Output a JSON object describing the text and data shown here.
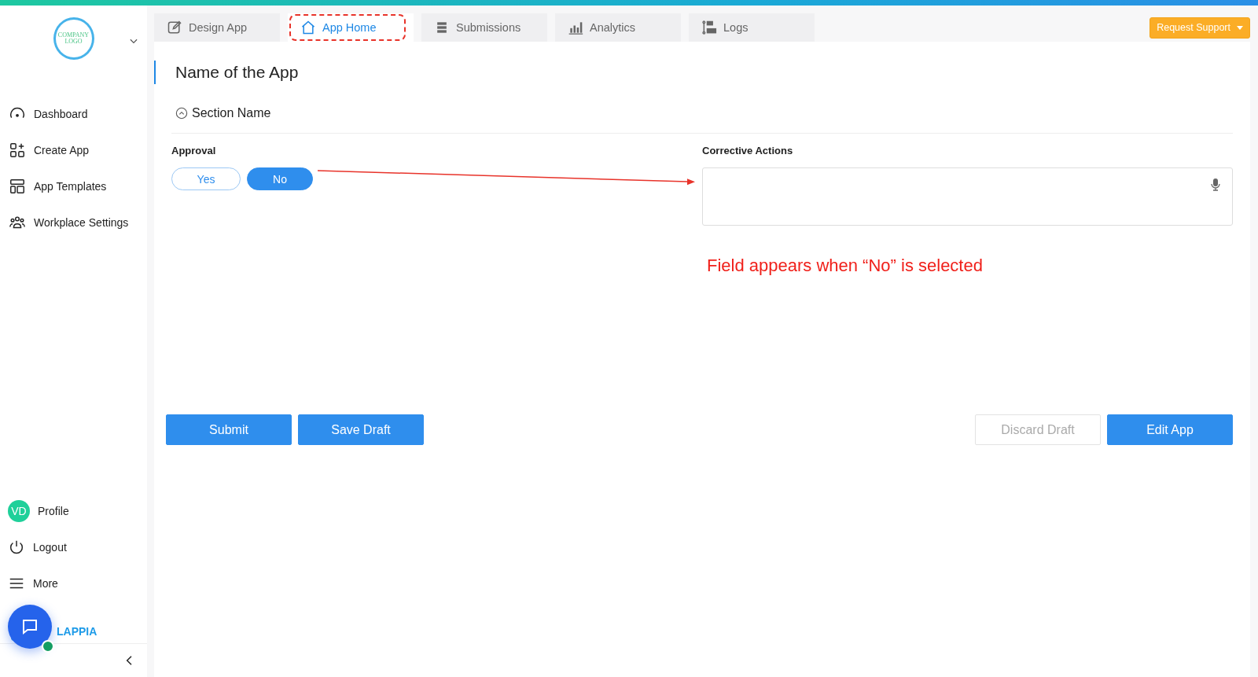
{
  "sidebar": {
    "logo_text": "COMPANY LOGO",
    "nav": [
      {
        "label": "Dashboard"
      },
      {
        "label": "Create App"
      },
      {
        "label": "App Templates"
      },
      {
        "label": "Workplace Settings"
      }
    ],
    "profile": {
      "initials": "VD",
      "label": "Profile"
    },
    "bottom": [
      {
        "label": "Logout"
      },
      {
        "label": "More"
      }
    ],
    "brand": "LAPPIA"
  },
  "tabs": [
    {
      "label": "Design App",
      "selected": false,
      "highlighted": false
    },
    {
      "label": "App Home",
      "selected": true,
      "highlighted": true
    },
    {
      "label": "Submissions",
      "selected": false,
      "highlighted": false
    },
    {
      "label": "Analytics",
      "selected": false,
      "highlighted": false
    },
    {
      "label": "Logs",
      "selected": false,
      "highlighted": false
    }
  ],
  "request_support": "Request Support",
  "app_title": "Name of the App",
  "section": {
    "title": "Section Name",
    "expanded": true
  },
  "approval": {
    "label": "Approval",
    "options": [
      {
        "label": "Yes",
        "selected": false
      },
      {
        "label": "No",
        "selected": true
      }
    ]
  },
  "corrective_actions": {
    "label": "Corrective Actions"
  },
  "annotation": "Field appears when “No” is selected",
  "actions_left": [
    "Submit",
    "Save Draft"
  ],
  "actions_right": [
    {
      "label": "Discard Draft",
      "disabled": true
    },
    {
      "label": "Edit App",
      "disabled": false
    }
  ]
}
